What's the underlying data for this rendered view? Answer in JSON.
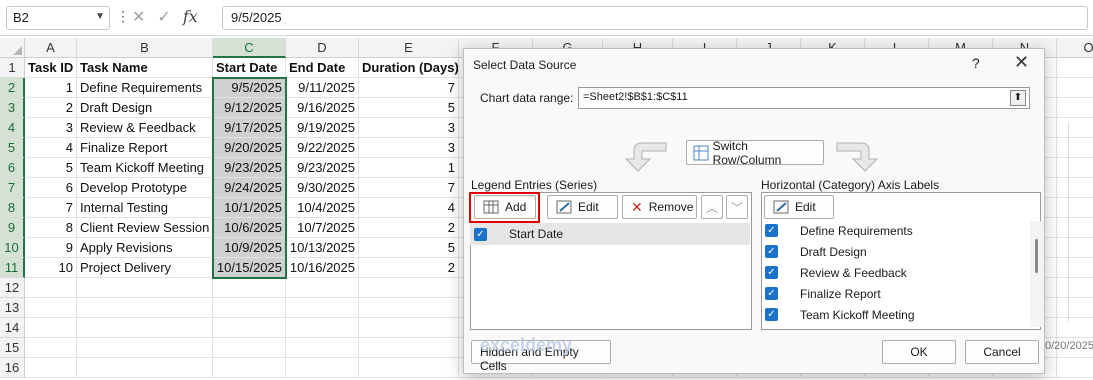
{
  "formula_bar": {
    "name_box": "B2",
    "formula": "9/5/2025"
  },
  "columns": [
    "A",
    "B",
    "C",
    "D",
    "E",
    "F",
    "G",
    "H",
    "I",
    "J",
    "K",
    "L",
    "M",
    "N",
    "O"
  ],
  "rows": [
    "1",
    "2",
    "3",
    "4",
    "5",
    "6",
    "7",
    "8",
    "9",
    "10",
    "11",
    "12",
    "13",
    "14",
    "15",
    "16"
  ],
  "table": {
    "headers": [
      "Task ID",
      "Task Name",
      "Start Date",
      "End Date",
      "Duration (Days)"
    ],
    "data": [
      [
        "1",
        "Define Requirements",
        "9/5/2025",
        "9/11/2025",
        "7"
      ],
      [
        "2",
        "Draft Design",
        "9/12/2025",
        "9/16/2025",
        "5"
      ],
      [
        "3",
        "Review & Feedback",
        "9/17/2025",
        "9/19/2025",
        "3"
      ],
      [
        "4",
        "Finalize Report",
        "9/20/2025",
        "9/22/2025",
        "3"
      ],
      [
        "5",
        "Team Kickoff Meeting",
        "9/23/2025",
        "9/23/2025",
        "1"
      ],
      [
        "6",
        "Develop Prototype",
        "9/24/2025",
        "9/30/2025",
        "7"
      ],
      [
        "7",
        "Internal Testing",
        "10/1/2025",
        "10/4/2025",
        "4"
      ],
      [
        "8",
        "Client Review Session",
        "10/6/2025",
        "10/7/2025",
        "2"
      ],
      [
        "9",
        "Apply Revisions",
        "10/9/2025",
        "10/13/2025",
        "5"
      ],
      [
        "10",
        "Project Delivery",
        "10/15/2025",
        "10/16/2025",
        "2"
      ]
    ]
  },
  "dialog": {
    "title": "Select Data Source",
    "help": "?",
    "close": "✕",
    "range_label": "Chart data range:",
    "range_value": "=Sheet2!$B$1:$C$11",
    "switch_label": "Switch Row/Column",
    "legend_label": "Legend Entries (Series)",
    "axis_label": "Horizontal (Category) Axis Labels",
    "add_label": "Add",
    "edit_label": "Edit",
    "remove_label": "Remove",
    "axis_edit_label": "Edit",
    "series": [
      "Start Date"
    ],
    "axis_items": [
      "Define Requirements",
      "Draft Design",
      "Review & Feedback",
      "Finalize Report",
      "Team Kickoff Meeting"
    ],
    "hidden_label": "Hidden and Empty Cells",
    "ok_label": "OK",
    "cancel_label": "Cancel"
  },
  "watermark": "exceldemy",
  "background_text": "0/20/2025",
  "colors": {
    "accent": "#217346",
    "highlight_red": "#e20000",
    "checkbox_blue": "#1a73c8"
  }
}
